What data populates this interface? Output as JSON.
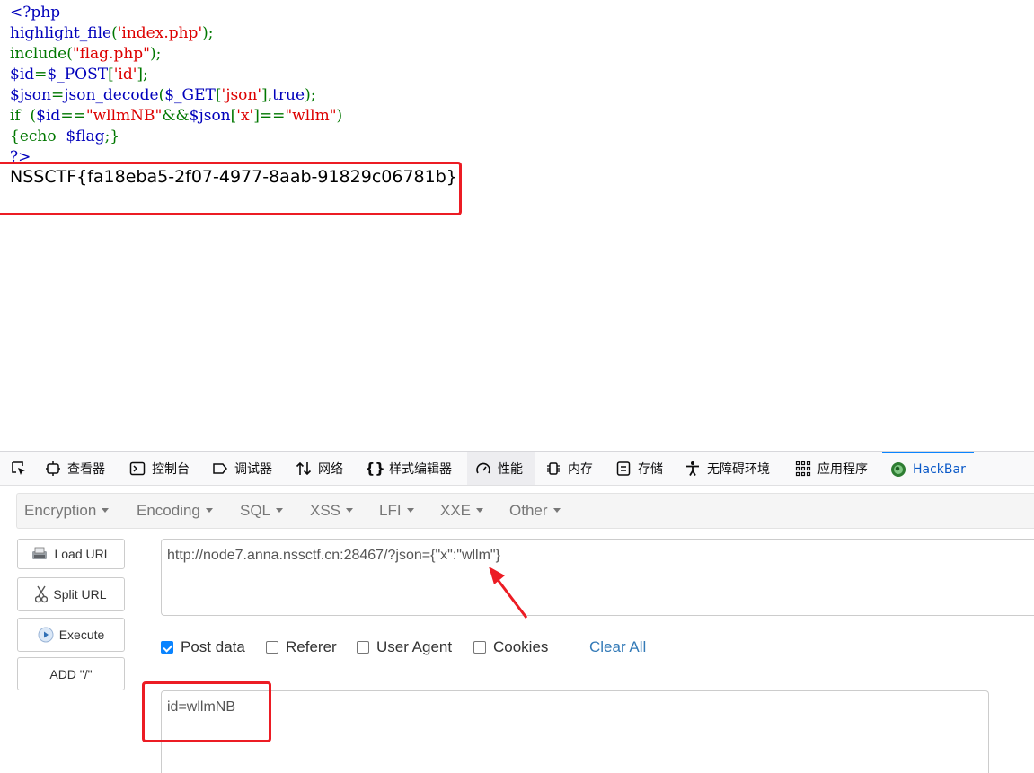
{
  "source": {
    "line1": "<?php",
    "line2_fn": "highlight_file",
    "line2_open": "(",
    "line2_str": "'index.php'",
    "line2_close": ");",
    "line3_fn": "include",
    "line3_open": "(",
    "line3_str": "\"flag.php\"",
    "line3_close": ");",
    "line4_var": "$id",
    "line4_eq": "=",
    "line4_post": "$_POST",
    "line4_br1": "[",
    "line4_str": "'id'",
    "line4_br2": "];",
    "line5_var": "$json",
    "line5_eq": "=",
    "line5_fn": "json_decode",
    "line5_p1": "(",
    "line5_get": "$_GET",
    "line5_br1": "[",
    "line5_str": "'json'",
    "line5_br2": "],",
    "line5_true": "true",
    "line5_end": ");",
    "line6_if": "if  (",
    "line6_var": "$id",
    "line6_eq": "==",
    "line6_str1": "\"wllmNB\"",
    "line6_and": "&&",
    "line6_json": "$json",
    "line6_br1": "[",
    "line6_x": "'x'",
    "line6_br2": "]==",
    "line6_str2": "\"wllm\"",
    "line6_end": ")",
    "line7_open": "{echo  ",
    "line7_var": "$flag",
    "line7_close": ";}",
    "line8": "?>"
  },
  "flag": "NSSCTF{fa18eba5-2f07-4977-8aab-91829c06781b}",
  "devtools": {
    "tabs": [
      {
        "label": ""
      },
      {
        "label": "查看器"
      },
      {
        "label": "控制台"
      },
      {
        "label": "调试器"
      },
      {
        "label": "网络"
      },
      {
        "label": "样式编辑器"
      },
      {
        "label": "性能"
      },
      {
        "label": "内存"
      },
      {
        "label": "存储"
      },
      {
        "label": "无障碍环境"
      },
      {
        "label": "应用程序"
      },
      {
        "label": "HackBar"
      }
    ]
  },
  "hackbar": {
    "menu": [
      "Encryption",
      "Encoding",
      "SQL",
      "XSS",
      "LFI",
      "XXE",
      "Other"
    ],
    "buttons": {
      "load_url": "Load URL",
      "split_url": "Split URL",
      "execute": "Execute",
      "add_slash": "ADD \"/\""
    },
    "url_value": "http://node7.anna.nssctf.cn:28467/?json={\"x\":\"wllm\"}",
    "checkboxes": [
      {
        "label": "Post data",
        "checked": true
      },
      {
        "label": "Referer",
        "checked": false
      },
      {
        "label": "User Agent",
        "checked": false
      },
      {
        "label": "Cookies",
        "checked": false
      }
    ],
    "clear_all": "Clear All",
    "post_value": "id=wllmNB"
  },
  "colors": {
    "highlight_box": "#ec1c24",
    "php_default": "#0000bb",
    "php_keyword": "#007700",
    "php_string": "#dd0000",
    "hackbar_accent": "#0a84ff"
  }
}
